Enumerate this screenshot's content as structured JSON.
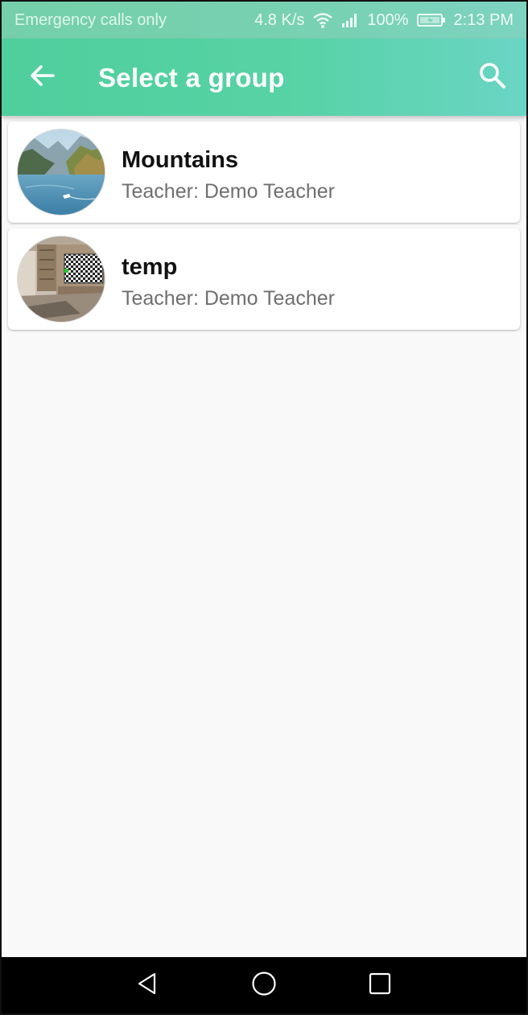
{
  "status_bar": {
    "carrier": "Emergency calls only",
    "speed": "4.8 K/s",
    "battery": "100%",
    "time": "2:13 PM"
  },
  "app_bar": {
    "title": "Select a group",
    "back_icon": "arrow-back-icon",
    "search_icon": "search-icon"
  },
  "groups": [
    {
      "name": "Mountains",
      "teacher": "Teacher: Demo Teacher",
      "avatar": "mountain-lake-photo"
    },
    {
      "name": "temp",
      "teacher": "Teacher: Demo Teacher",
      "avatar": "room-interior-photo"
    }
  ],
  "nav_bar": {
    "back_icon": "triangle-back-icon",
    "home_icon": "circle-home-icon",
    "recents_icon": "square-recents-icon"
  },
  "colors": {
    "app_bar_start": "#4fcf9c",
    "app_bar_end": "#6ad5c4",
    "status_bar": "#78d1b2",
    "background": "#f9f9f9"
  }
}
